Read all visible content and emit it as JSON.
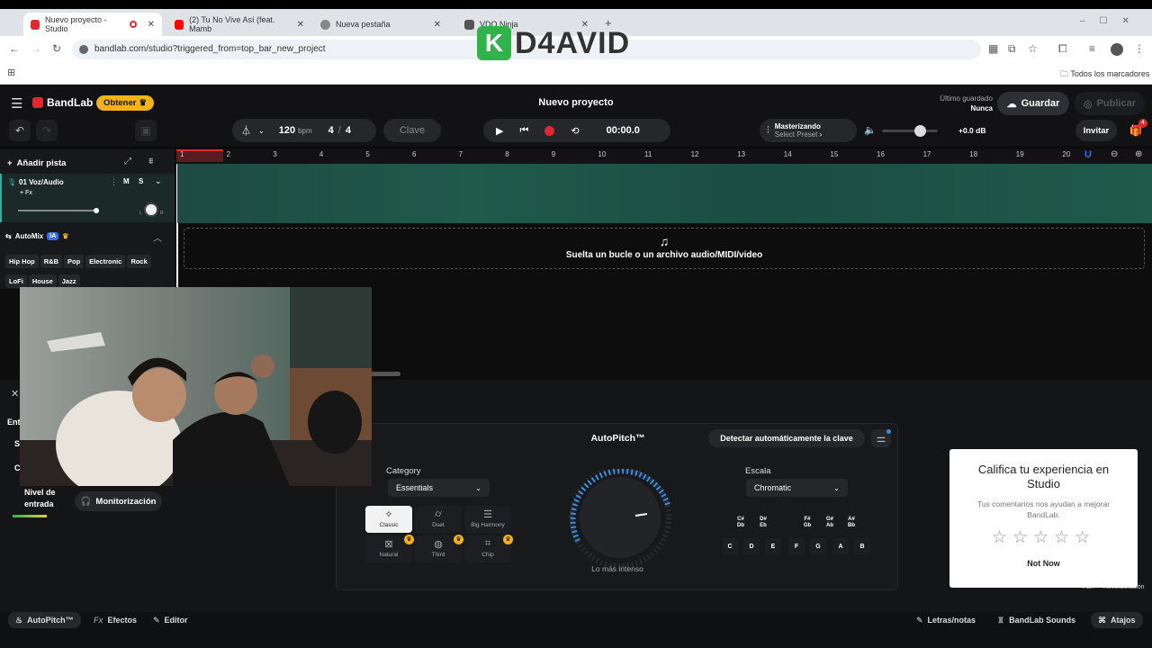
{
  "browser": {
    "tabs": [
      {
        "label": "Nuevo proyecto - Studio",
        "close": "✕"
      },
      {
        "label": "(2) Tu No Vive Así (feat. Mamb",
        "close": "✕"
      },
      {
        "label": "Nueva pestaña",
        "close": "✕"
      },
      {
        "label": "VDO.Ninja",
        "close": "✕"
      }
    ],
    "new_tab": "+",
    "url": "bandlab.com/studio?triggered_from=top_bar_new_project",
    "bookmarks_label": "Todos los marcadores",
    "watermark": "D4AVID",
    "watermark_k": "K"
  },
  "app": {
    "logo": "BandLab",
    "obtener": "Obtener",
    "project_title": "Nuevo proyecto",
    "last_saved_label": "Último guardado",
    "last_saved_value": "Nunca",
    "save": "Guardar",
    "publish": "Publicar",
    "bpm_value": "120",
    "bpm_unit": "bpm",
    "time_sig_num": "4",
    "time_sig_sep": "/",
    "time_sig_den": "4",
    "key_label": "Clave",
    "time_display": "00:00.0",
    "mastering_title": "Masterizando",
    "mastering_sub": "Select Preset",
    "db_value": "+0.0 dB",
    "invite": "Invitar",
    "notif_count": "4"
  },
  "ruler": {
    "marks": [
      "1",
      "2",
      "3",
      "4",
      "5",
      "6",
      "7",
      "8",
      "9",
      "10",
      "11",
      "12",
      "13",
      "14",
      "15",
      "16",
      "17",
      "18",
      "19",
      "20"
    ]
  },
  "track": {
    "add_track": "Añadir pista",
    "name": "01  Voz/Audio",
    "fx": "+ Fx",
    "m": "M",
    "s": "S",
    "l": "L",
    "r": "R"
  },
  "automix": {
    "label": "AutoMix",
    "ai_badge": "IA",
    "genres": [
      "Hip Hop",
      "R&B",
      "Pop",
      "Electronic",
      "Rock",
      "LoFi",
      "House",
      "Jazz"
    ]
  },
  "drop_zone": {
    "text": "Suelta un bucle o un archivo audio/MIDI/video"
  },
  "input_panel": {
    "entrada": "Ent",
    "level_label": "Nivel de entrada",
    "monitor": "Monitorización",
    "s_letter": "S",
    "c_letter": "C"
  },
  "autopitch": {
    "title": "AutoPitch™",
    "detect_button": "Detectar automáticamente la clave",
    "category_label": "Category",
    "category_value": "Essentials",
    "styles": [
      "Classic",
      "Duet",
      "Big Harmony",
      "Natural",
      "Third",
      "Chip"
    ],
    "knob_label": "Lo más intenso",
    "scale_label": "Escala",
    "scale_value": "Chromatic",
    "sharps": [
      "C#\nDb",
      "D#\nEb",
      "F#\nGb",
      "G#\nAb",
      "A#\nBb"
    ],
    "naturals": [
      "C",
      "D",
      "E",
      "F",
      "G",
      "A",
      "B"
    ]
  },
  "rating": {
    "title": "Califica tu experiencia en Studio",
    "subtitle": "Tus comentarios nos ayudan a mejorar BandLab.",
    "stars": 5,
    "not_now": "Not Now"
  },
  "side_labels": {
    "fan": "Fan",
    "reverb": "Reverberación"
  },
  "footer": {
    "autopitch": "AutoPitch™",
    "efectos": "Efectos",
    "editor": "Editor",
    "letras": "Letras/notas",
    "sounds": "BandLab Sounds",
    "atajos": "Atajos"
  },
  "colors": {
    "accent_red": "#e0282e",
    "track_green": "#1f5a4b",
    "obtener_yellow": "#f3b218",
    "knob_blue": "#3a8ee6"
  }
}
